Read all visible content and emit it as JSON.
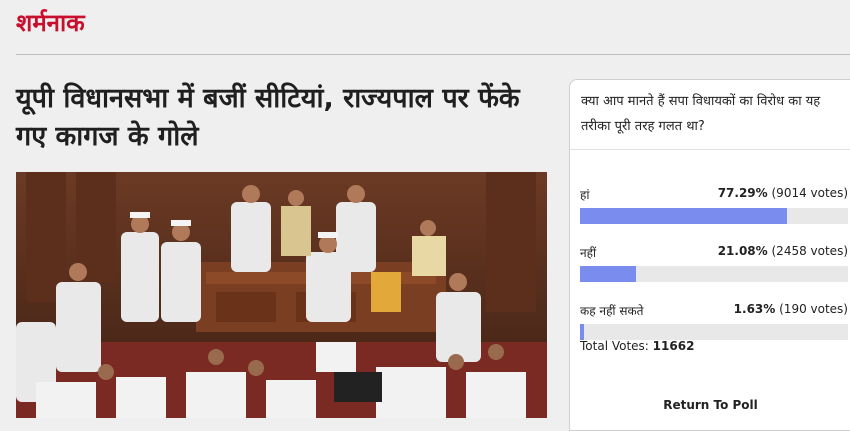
{
  "section": {
    "title": "शर्मनाक"
  },
  "article": {
    "headline": "यूपी विधानसभा में बजीं सीटियां, राज्यपाल पर फेंके गए कागज के गोले"
  },
  "poll": {
    "question": "क्या आप मानते हैं सपा विधायकों का विरोध का यह तरीका पूरी तरह गलत था?",
    "options": [
      {
        "label": "हां",
        "percent": "77.29%",
        "votes": "(9014 votes)",
        "fraction": 0.7729
      },
      {
        "label": "नहीं",
        "percent": "21.08%",
        "votes": "(2458 votes)",
        "fraction": 0.2108
      },
      {
        "label": "कह नहीं सकते",
        "percent": "1.63%",
        "votes": "(190 votes)",
        "fraction": 0.0163
      }
    ],
    "total_label": "Total Votes:",
    "total_value": "11662",
    "return_label": "Return To Poll",
    "bar_color": "#7b8cef"
  },
  "colors": {
    "accent": "#c8102e"
  }
}
